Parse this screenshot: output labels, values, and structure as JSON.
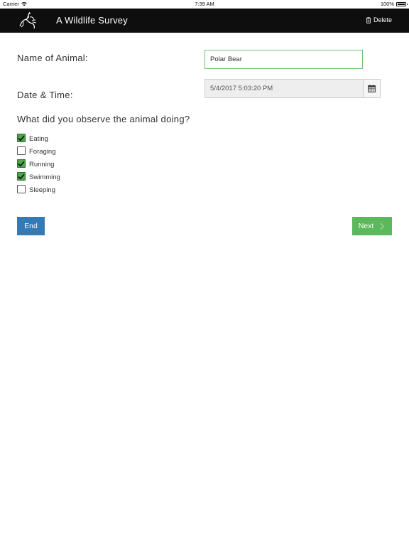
{
  "status_bar": {
    "carrier": "Carrier",
    "time": "7:39 AM",
    "battery": "100%"
  },
  "header": {
    "title": "A Wildlife Survey",
    "delete_label": "Delete",
    "logo_icon": "wildlife-logo-icon",
    "delete_icon": "trash-icon",
    "background_color": "#0e0e0e"
  },
  "form": {
    "name_label": "Name of Animal:",
    "name_value": "Polar Bear",
    "date_label": "Date & Time:",
    "date_value": "5/4/2017 5:03:20 PM",
    "observe_question": "What did you observe the animal doing?",
    "observations": [
      {
        "label": "Eating",
        "checked": true
      },
      {
        "label": "Foraging",
        "checked": false
      },
      {
        "label": "Running",
        "checked": true
      },
      {
        "label": "Swimming",
        "checked": true
      },
      {
        "label": "Sleeping",
        "checked": false
      }
    ]
  },
  "actions": {
    "end_label": "End",
    "next_label": "Next",
    "end_color": "#337ab7",
    "next_color": "#5cb85c"
  }
}
